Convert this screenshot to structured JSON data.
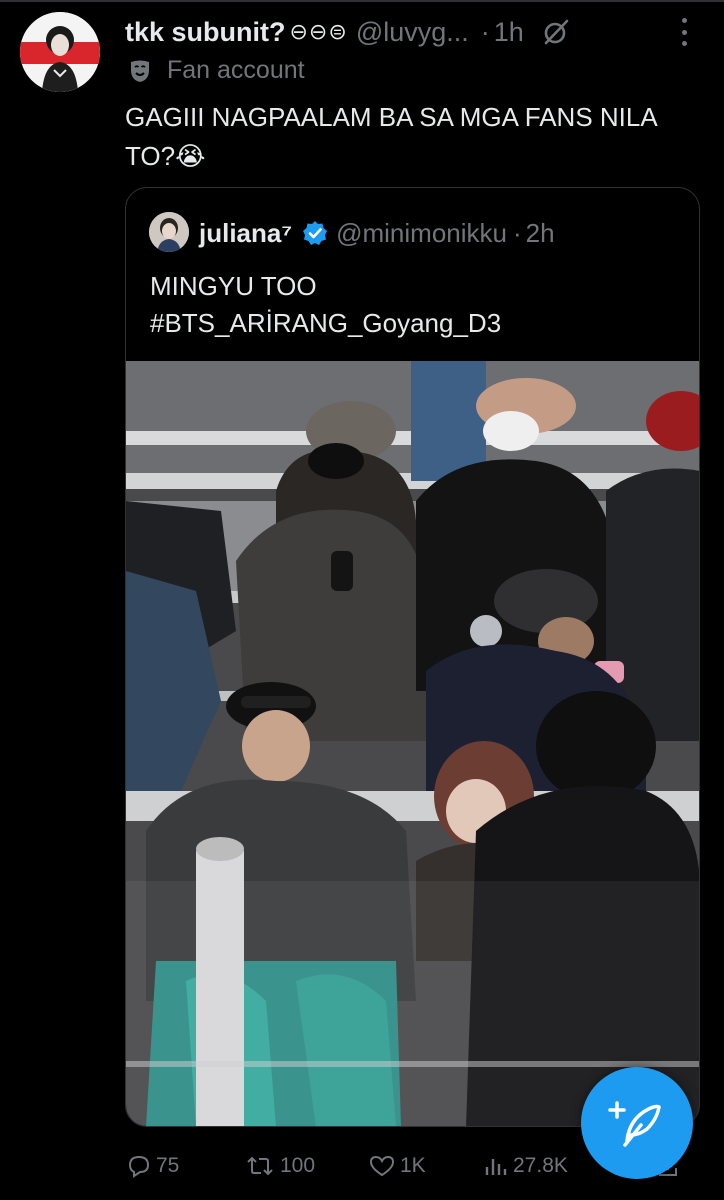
{
  "post": {
    "display_name": "tkk subunit?",
    "name_emoji": "⊖⊖⊜",
    "handle": "@luvyg...",
    "separator": "·",
    "time": "1h",
    "account_label": "Fan account",
    "text": "GAGIII NAGPAALAM BA SA MGA FANS NILA TO?😭",
    "avatar_icon": "profile-photo"
  },
  "quote": {
    "display_name": "juliana⁷",
    "handle": "@minimonikku",
    "separator": "·",
    "time": "2h",
    "text_line1": "MINGYU TOO",
    "text_line2": "#BTS_ARİRANG_Goyang_D3",
    "verified_color": "#1d9bf0"
  },
  "actions": {
    "replies": "75",
    "reposts": "100",
    "likes": "1K",
    "views": "27.8K"
  },
  "colors": {
    "background": "#000000",
    "text": "#e7e9ea",
    "muted": "#71767b",
    "accent": "#1d9bf0"
  }
}
